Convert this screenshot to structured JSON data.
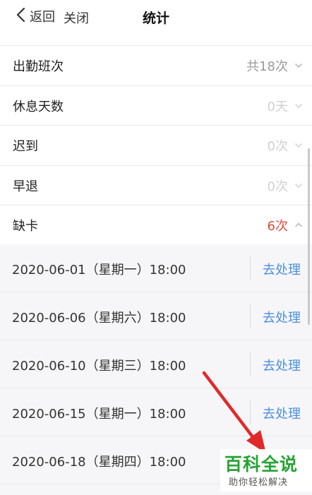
{
  "header": {
    "back_label": "返回",
    "close_label": "关闭",
    "title": "统计"
  },
  "stats": [
    {
      "label": "出勤班次",
      "value": "共18次",
      "value_style": "gray",
      "chevron": "chevron-down"
    },
    {
      "label": "休息天数",
      "value": "0天",
      "value_style": "light",
      "chevron": "chevron-down"
    },
    {
      "label": "迟到",
      "value": "0次",
      "value_style": "light",
      "chevron": "chevron-down"
    },
    {
      "label": "早退",
      "value": "0次",
      "value_style": "light",
      "chevron": "chevron-down"
    },
    {
      "label": "缺卡",
      "value": "6次",
      "value_style": "red",
      "chevron": "chevron-up"
    }
  ],
  "missing_records": [
    {
      "date": "2020-06-01（星期一）18:00",
      "action": "去处理"
    },
    {
      "date": "2020-06-06（星期六）18:00",
      "action": "去处理"
    },
    {
      "date": "2020-06-10（星期三）18:00",
      "action": "去处理"
    },
    {
      "date": "2020-06-15（星期一）18:00",
      "action": "去处理"
    },
    {
      "date": "2020-06-18（星期四）18:00",
      "action": ""
    }
  ],
  "watermark": {
    "main": "百科全说",
    "sub": "助你轻松解决"
  },
  "colors": {
    "accent_blue": "#4a8fe0",
    "alert_red": "#e14a3b",
    "annotation_arrow": "#e02a2a",
    "watermark_green": "#27a334"
  }
}
